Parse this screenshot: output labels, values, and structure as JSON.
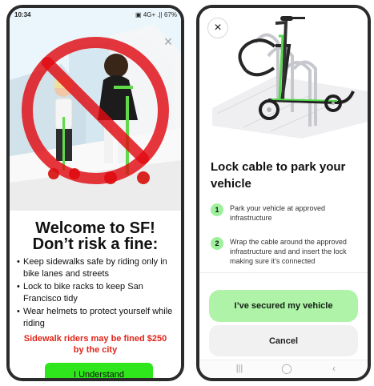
{
  "left_phone": {
    "status_time": "10:34",
    "status_icons": "▣ 4G+ .|| 67%",
    "close_label": "×",
    "title_line1": "Welcome to SF!",
    "title_line2": "Don’t risk a fine:",
    "tips": [
      "Keep sidewalks safe by riding only in bike lanes and streets",
      "Lock to bike racks to keep San Francisco tidy",
      "Wear helmets to protect yourself while riding"
    ],
    "warning": "Sidewalk riders may be fined $250 by the city",
    "understand_label": "I Understand"
  },
  "right_phone": {
    "close_label": "×",
    "title": "Lock cable to park your vehicle",
    "steps": [
      {
        "number": "1",
        "text": "Park your vehicle at approved infrastructure"
      },
      {
        "number": "2",
        "text": "Wrap the cable around the approved infrastructure and and insert the lock making sure it’s connected"
      }
    ],
    "secure_button": "I’ve secured my vehicle",
    "cancel_button": "Cancel",
    "nav": {
      "recent": "|||",
      "home": "◯",
      "back": "‹"
    }
  },
  "colors": {
    "green_primary": "#2ee61b",
    "green_soft": "#aef3a8",
    "red_warning": "#e2241a",
    "gray_button": "#f1f1f1"
  },
  "icons": {
    "close": "close-icon",
    "battery": "battery-icon",
    "signal": "signal-icon",
    "back": "back-icon",
    "home": "home-icon",
    "recent": "recent-apps-icon"
  }
}
